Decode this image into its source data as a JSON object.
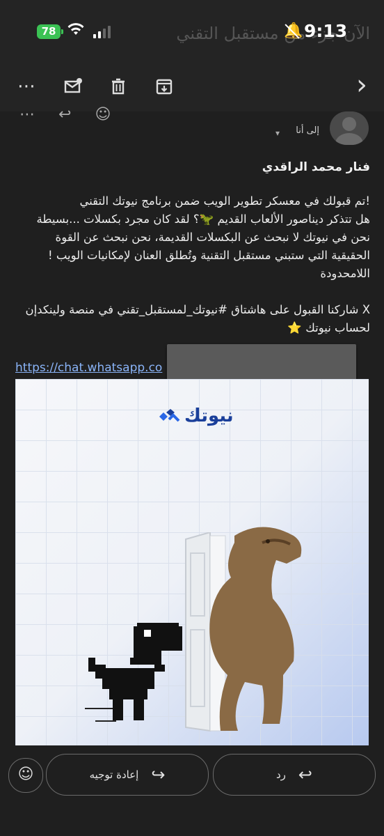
{
  "status_bar": {
    "battery": "78",
    "time": "9:13",
    "ghost_subject": "الآن جزء من مستقبل التقني"
  },
  "toolbar": {
    "more": "⋯",
    "mark_unread": "mark-unread-icon",
    "delete": "delete-icon",
    "archive": "archive-icon",
    "next": "›"
  },
  "email": {
    "to_label": "إلى أنا",
    "caret": "▾",
    "sender": "فنار محمد الراقدي",
    "paragraph_1": "!تم قبولك في معسكر تطوير الويب ضمن برنامج نيوتك التقني\nهل تتذكر ديناصور الألعاب القديم 🦖؟ لقد كان مجرد بكسلات ...بسيطة\nنحن في نيوتك لا نبحث عن البكسلات القديمة، نحن نبحث عن القوة الحقيقية التي ستبني مستقبل التقنية وتُطلق العنان لإمكانيات الويب !اللامحدودة",
    "paragraph_2": "X شاركنا القبول على هاشتاق #نيوتك_لمستقبل_تقني في منصة ولينكدإن لحساب نيوتك ⭐",
    "link": "https://chat.whatsapp.co"
  },
  "banner": {
    "brand": "نيوتك",
    "image": "dinosaur-illustration"
  },
  "actions": {
    "reply": "رد",
    "forward": "إعادة توجيه",
    "emoji": "☺"
  }
}
